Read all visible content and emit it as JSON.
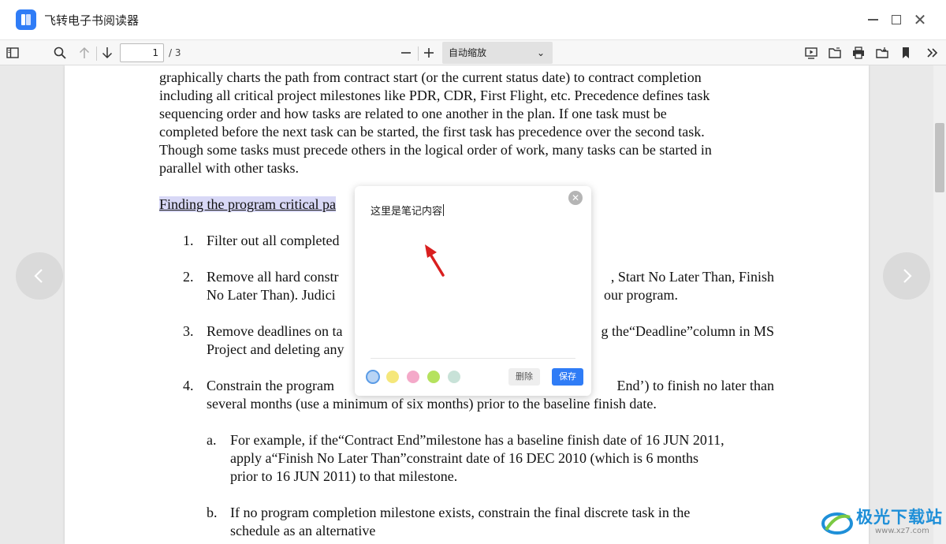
{
  "app": {
    "title": "飞转电子书阅读器"
  },
  "toolbar": {
    "page_current": "1",
    "page_total": "/ 3",
    "zoom_label": "自动缩放"
  },
  "document": {
    "para1_lines": [
      "graphically charts the path from contract start (or the current status date) to contract completion",
      "including all critical project milestones like PDR, CDR, First Flight, etc. Precedence defines task",
      "sequencing order and how tasks are related to one another in the plan. If one task must be",
      "completed before the next task can be started, the first task has precedence over the second task.",
      "Though some tasks must precede others in the logical order of work, many tasks can be started in",
      "parallel with other tasks."
    ],
    "heading": "Finding the program critical pa",
    "items": [
      {
        "num": "1.",
        "left": "Filter out all completed",
        "right": ""
      },
      {
        "num": "2.",
        "left": "Remove all hard constr",
        "right": ", Start No Later Than, Finish",
        "line2_left": "No Later Than).  Judici",
        "line2_right": "our program."
      },
      {
        "num": "3.",
        "left": "Remove deadlines on ta",
        "right": "g the“Deadline”column in MS",
        "line2_left": "Project and deleting any",
        "line2_right": ""
      },
      {
        "num": "4.",
        "left": "Constrain the program",
        "right": "End’) to finish no later than",
        "line2": "several months (use a minimum of six months) prior to the baseline finish date."
      }
    ],
    "sub_a": {
      "num": "a.",
      "lines": [
        "For example, if the“Contract End”milestone has a baseline finish date of 16 JUN 2011,",
        "apply a“Finish No Later Than”constraint date of 16 DEC 2010 (which is 6 months",
        "prior to 16 JUN 2011) to that milestone."
      ]
    },
    "sub_b": {
      "num": "b.",
      "lines": [
        "If no program completion milestone exists, constrain the final discrete task in the",
        "schedule as an alternative"
      ]
    }
  },
  "note": {
    "text": "这里是笔记内容",
    "delete_label": "删除",
    "save_label": "保存",
    "colors": [
      "#b8d4f5",
      "#f5e77b",
      "#f4a9c9",
      "#b5e25e",
      "#c8e2d8"
    ]
  },
  "watermark": {
    "name": "极光下载站",
    "url": "www.xz7.com"
  }
}
